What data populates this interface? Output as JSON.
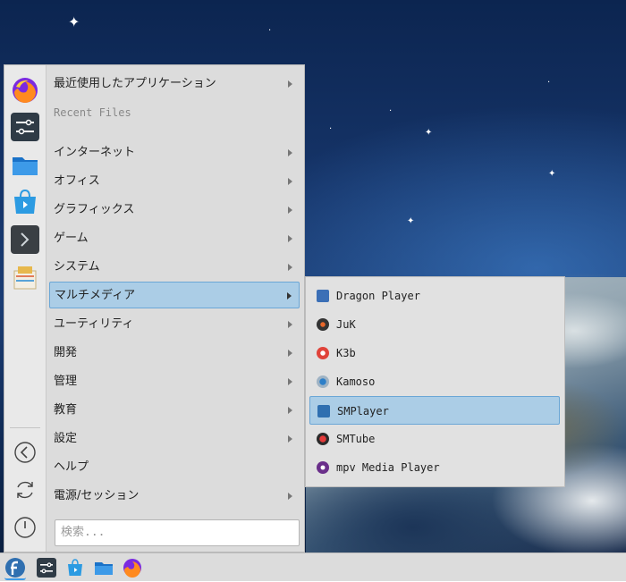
{
  "menu": {
    "recent_apps": "最近使用したアプリケーション",
    "recent_files": "Recent Files",
    "categories": [
      {
        "label": "インターネット"
      },
      {
        "label": "オフィス"
      },
      {
        "label": "グラフィックス"
      },
      {
        "label": "ゲーム"
      },
      {
        "label": "システム"
      },
      {
        "label": "マルチメディア"
      },
      {
        "label": "ユーティリティ"
      },
      {
        "label": "開発"
      },
      {
        "label": "管理"
      },
      {
        "label": "教育"
      },
      {
        "label": "設定"
      },
      {
        "label": "ヘルプ"
      },
      {
        "label": "電源/セッション"
      }
    ],
    "selected_category": "マルチメディア",
    "search_placeholder": "検索..."
  },
  "submenu": {
    "items": [
      {
        "label": "Dragon Player",
        "icon": "dragon-player-icon"
      },
      {
        "label": "JuK",
        "icon": "juk-icon"
      },
      {
        "label": "K3b",
        "icon": "k3b-icon"
      },
      {
        "label": "Kamoso",
        "icon": "kamoso-icon"
      },
      {
        "label": "SMPlayer",
        "icon": "smplayer-icon"
      },
      {
        "label": "SMTube",
        "icon": "smtube-icon"
      },
      {
        "label": "mpv Media Player",
        "icon": "mpv-icon"
      }
    ],
    "selected": "SMPlayer"
  },
  "favorites": [
    "firefox-icon",
    "system-settings-icon",
    "file-manager-icon",
    "software-center-icon",
    "terminal-icon",
    "archive-icon"
  ],
  "side_actions": [
    "back-icon",
    "refresh-icon",
    "power-icon"
  ],
  "taskbar": [
    "fedora-menu-icon",
    "system-settings-icon",
    "software-center-icon",
    "file-manager-icon",
    "firefox-icon"
  ],
  "colors": {
    "selection": "#abcde6",
    "selection_border": "#6aa6d6"
  }
}
